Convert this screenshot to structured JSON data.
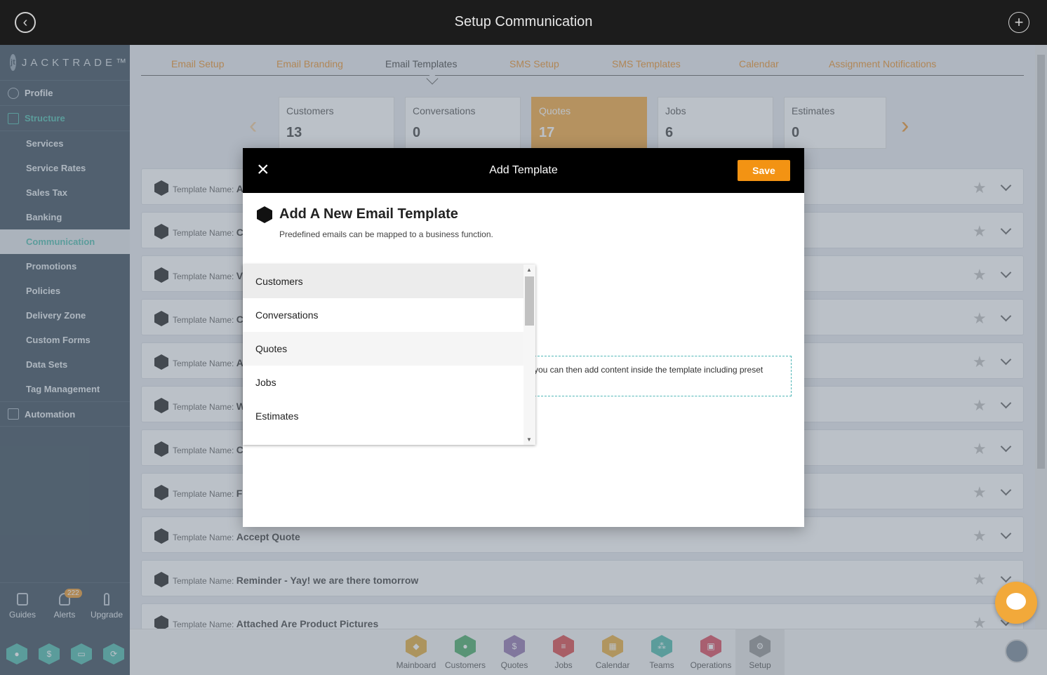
{
  "header": {
    "title": "Setup Communication"
  },
  "sidebar": {
    "logo_text": "JACKTRADE™",
    "profile": "Profile",
    "structure": "Structure",
    "items": [
      {
        "label": "Services"
      },
      {
        "label": "Service Rates"
      },
      {
        "label": "Sales Tax"
      },
      {
        "label": "Banking"
      },
      {
        "label": "Communication"
      },
      {
        "label": "Promotions"
      },
      {
        "label": "Policies"
      },
      {
        "label": "Delivery Zone"
      },
      {
        "label": "Custom Forms"
      },
      {
        "label": "Data Sets"
      },
      {
        "label": "Tag Management"
      }
    ],
    "automation": "Automation",
    "bottom": {
      "guides": "Guides",
      "alerts": "Alerts",
      "alerts_count": "222",
      "upgrade": "Upgrade"
    }
  },
  "tabs": [
    {
      "label": "Email Setup"
    },
    {
      "label": "Email Branding"
    },
    {
      "label": "Email Templates"
    },
    {
      "label": "SMS Setup"
    },
    {
      "label": "SMS Templates"
    },
    {
      "label": "Calendar"
    },
    {
      "label": "Assignment Notifications"
    }
  ],
  "cards": [
    {
      "title": "Customers",
      "value": "13"
    },
    {
      "title": "Conversations",
      "value": "0"
    },
    {
      "title": "Quotes",
      "value": "17"
    },
    {
      "title": "Jobs",
      "value": "6"
    },
    {
      "title": "Estimates",
      "value": "0"
    }
  ],
  "templates": {
    "label": "Template Name:",
    "rows": [
      {
        "name": "A"
      },
      {
        "name": "C"
      },
      {
        "name": "V"
      },
      {
        "name": "C"
      },
      {
        "name": "A"
      },
      {
        "name": "W"
      },
      {
        "name": "C"
      },
      {
        "name": "F"
      },
      {
        "name": "Accept Quote"
      },
      {
        "name": "Reminder - Yay! we are there tomorrow"
      },
      {
        "name": "Attached Are Product Pictures"
      }
    ]
  },
  "modal": {
    "title": "Add Template",
    "save": "Save",
    "heading": "Add A New Email Template",
    "subtitle": "Predefined emails can be mapped to a business function.",
    "hint": "you can then add content inside the template including preset",
    "dropdown": [
      "Customers",
      "Conversations",
      "Quotes",
      "Jobs",
      "Estimates"
    ]
  },
  "bottombar": [
    {
      "label": "Mainboard",
      "color": "#e0a42a"
    },
    {
      "label": "Customers",
      "color": "#3aa55a"
    },
    {
      "label": "Quotes",
      "color": "#8a6aa8"
    },
    {
      "label": "Jobs",
      "color": "#d9393b"
    },
    {
      "label": "Calendar",
      "color": "#e8a72c"
    },
    {
      "label": "Teams",
      "color": "#3fb5a4"
    },
    {
      "label": "Operations",
      "color": "#d93a4e"
    },
    {
      "label": "Setup",
      "color": "#8b8b8b"
    }
  ],
  "colors": {
    "accent": "#e8881a",
    "teal": "#3fb5a4",
    "sidebar": "#2a3d4c"
  }
}
